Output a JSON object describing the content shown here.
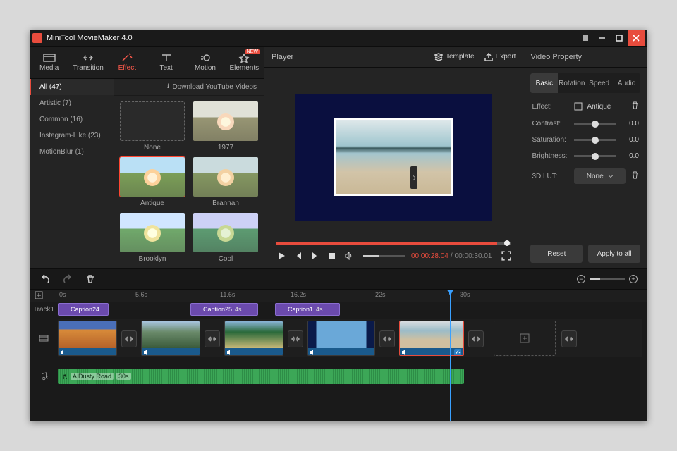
{
  "app_title": "MiniTool MovieMaker 4.0",
  "top_tabs": [
    {
      "label": "Media"
    },
    {
      "label": "Transition"
    },
    {
      "label": "Effect"
    },
    {
      "label": "Text"
    },
    {
      "label": "Motion"
    },
    {
      "label": "Elements",
      "badge": "NEW"
    }
  ],
  "download_link": "Download YouTube Videos",
  "categories": [
    {
      "label": "All (47)"
    },
    {
      "label": "Artistic (7)"
    },
    {
      "label": "Common (16)"
    },
    {
      "label": "Instagram-Like (23)"
    },
    {
      "label": "MotionBlur (1)"
    }
  ],
  "effects": [
    {
      "name": "None"
    },
    {
      "name": "1977"
    },
    {
      "name": "Antique"
    },
    {
      "name": "Brannan"
    },
    {
      "name": "Brooklyn"
    },
    {
      "name": "Cool"
    }
  ],
  "player": {
    "title": "Player",
    "template": "Template",
    "export": "Export",
    "time_current": "00:00:28.04",
    "time_sep": " / ",
    "time_total": "00:00:30.01"
  },
  "props": {
    "title": "Video Property",
    "tabs": [
      "Basic",
      "Rotation",
      "Speed",
      "Audio"
    ],
    "effect_label": "Effect:",
    "effect_name": "Antique",
    "contrast_label": "Contrast:",
    "contrast_val": "0.0",
    "saturation_label": "Saturation:",
    "saturation_val": "0.0",
    "brightness_label": "Brightness:",
    "brightness_val": "0.0",
    "lut_label": "3D LUT:",
    "lut_val": "None",
    "reset": "Reset",
    "apply_all": "Apply to all"
  },
  "timeline": {
    "ticks": [
      "0s",
      "5.6s",
      "11.6s",
      "16.2s",
      "22s",
      "30s"
    ],
    "track1_label": "Track1",
    "captions": [
      {
        "name": "Caption24"
      },
      {
        "name": "Caption25",
        "dur": "4s"
      },
      {
        "name": "Caption1",
        "dur": "4s"
      }
    ],
    "audio_name": "A Dusty Road",
    "audio_dur": "30s"
  }
}
